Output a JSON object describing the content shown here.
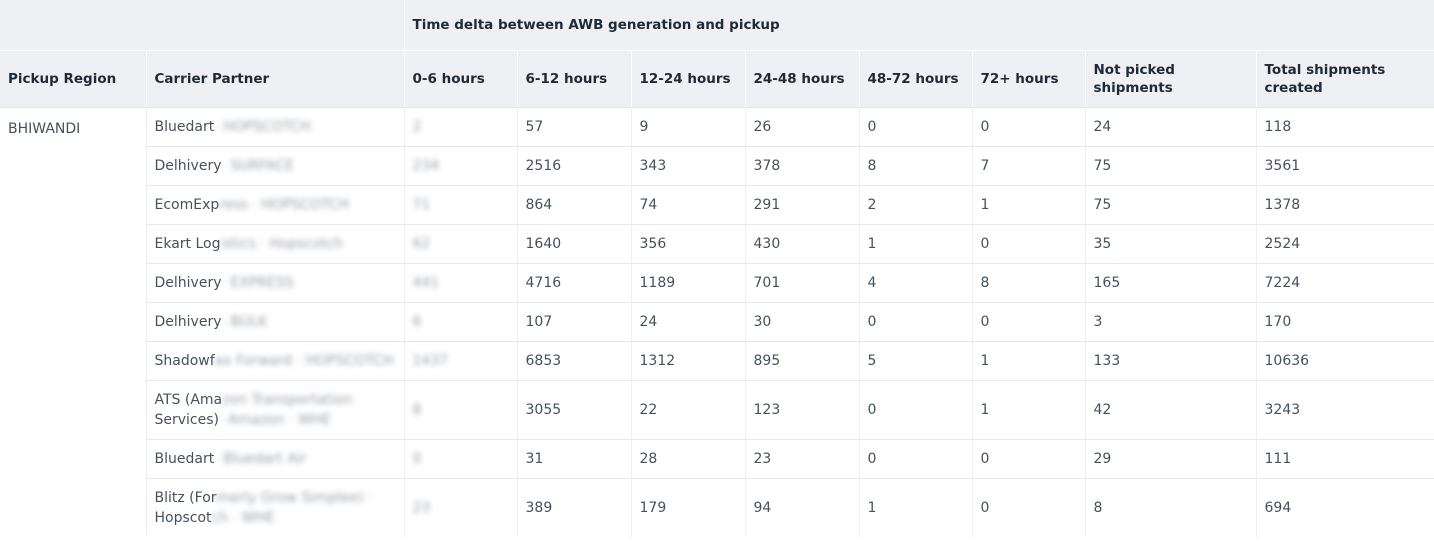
{
  "table": {
    "group_header": "Time delta between AWB generation and pickup",
    "columns": [
      "Pickup Region",
      "Carrier Partner",
      "0-6 hours",
      "6-12 hours",
      "12-24 hours",
      "24-48 hours",
      "48-72 hours",
      "72+ hours",
      "Not picked shipments",
      "Total shipments created"
    ],
    "region": "BHIWANDI",
    "rows": [
      {
        "carrier": "Bluedart",
        "carrier_suffix": "· HOPSCOTCH",
        "h0_6": "2",
        "h6_12": "57",
        "h12_24": "9",
        "h24_48": "26",
        "h48_72": "0",
        "h72p": "0",
        "not_picked": "24",
        "total": "118"
      },
      {
        "carrier": "Delhivery",
        "carrier_suffix": "· SURFACE",
        "h0_6": "234",
        "h6_12": "2516",
        "h12_24": "343",
        "h24_48": "378",
        "h48_72": "8",
        "h72p": "7",
        "not_picked": "75",
        "total": "3561"
      },
      {
        "carrier": "EcomExp",
        "carrier_suffix": "ress · HOPSCOTCH",
        "h0_6": "71",
        "h6_12": "864",
        "h12_24": "74",
        "h24_48": "291",
        "h48_72": "2",
        "h72p": "1",
        "not_picked": "75",
        "total": "1378"
      },
      {
        "carrier": "Ekart Log",
        "carrier_suffix": "istics · Hopscotch",
        "h0_6": "62",
        "h6_12": "1640",
        "h12_24": "356",
        "h24_48": "430",
        "h48_72": "1",
        "h72p": "0",
        "not_picked": "35",
        "total": "2524"
      },
      {
        "carrier": "Delhivery",
        "carrier_suffix": "· EXPRESS",
        "h0_6": "441",
        "h6_12": "4716",
        "h12_24": "1189",
        "h24_48": "701",
        "h48_72": "4",
        "h72p": "8",
        "not_picked": "165",
        "total": "7224"
      },
      {
        "carrier": "Delhivery",
        "carrier_suffix": "· BULK",
        "h0_6": "6",
        "h6_12": "107",
        "h12_24": "24",
        "h24_48": "30",
        "h48_72": "0",
        "h72p": "0",
        "not_picked": "3",
        "total": "170"
      },
      {
        "carrier": "Shadowf",
        "carrier_suffix": "ax Forward · HOPSCOTCH",
        "h0_6": "1437",
        "h6_12": "6853",
        "h12_24": "1312",
        "h24_48": "895",
        "h48_72": "5",
        "h72p": "1",
        "not_picked": "133",
        "total": "10636"
      },
      {
        "carrier": "ATS (Ama",
        "carrier_suffix": "zon Transportation",
        "carrier_line2": "Services)",
        "carrier_line2_suffix": "· Amazon · WHE",
        "h0_6": "8",
        "h6_12": "3055",
        "h12_24": "22",
        "h24_48": "123",
        "h48_72": "0",
        "h72p": "1",
        "not_picked": "42",
        "total": "3243"
      },
      {
        "carrier": "Bluedart",
        "carrier_suffix": "· Bluedart Air",
        "h0_6": "0",
        "h6_12": "31",
        "h12_24": "28",
        "h24_48": "23",
        "h48_72": "0",
        "h72p": "0",
        "not_picked": "29",
        "total": "111"
      },
      {
        "carrier": "Blitz (For",
        "carrier_suffix": "merly Grow Simplee) ·",
        "carrier_line2": "Hopscot",
        "carrier_line2_suffix": "ch · WHE",
        "h0_6": "23",
        "h6_12": "389",
        "h12_24": "179",
        "h24_48": "94",
        "h48_72": "1",
        "h72p": "0",
        "not_picked": "8",
        "total": "694"
      }
    ]
  }
}
